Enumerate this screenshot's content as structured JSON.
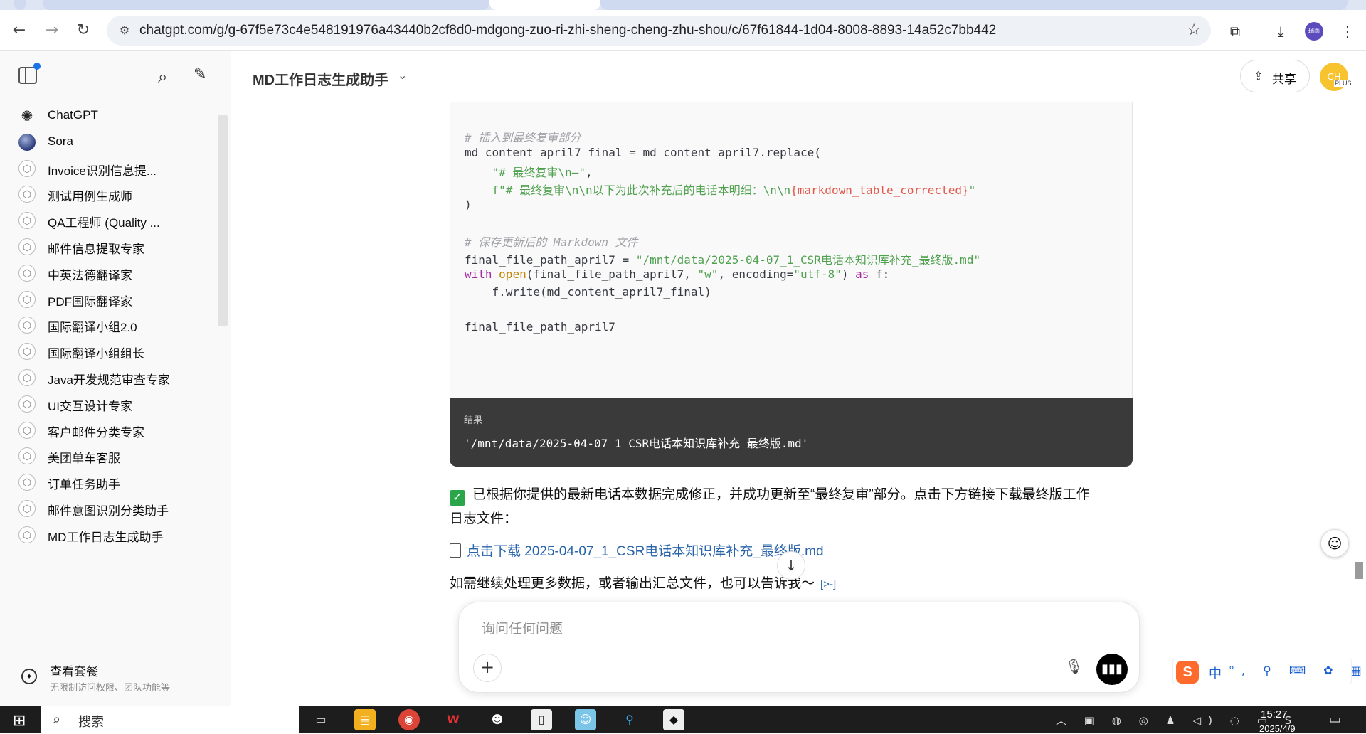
{
  "browser": {
    "url": "chatgpt.com/g/g-67f5e73c4e548191976a43440b2cf8d0-mdgong-zuo-ri-zhi-sheng-cheng-zhu-shou/c/67f61844-1d04-8008-8893-14a52c7bb442",
    "profile_label": "瑞雨"
  },
  "sidebar": {
    "items": [
      {
        "label": "ChatGPT",
        "icon": "openai-icon"
      },
      {
        "label": "Sora",
        "icon": "sora-icon"
      },
      {
        "label": "Invoice识别信息提...",
        "icon": "gpt-cube-icon"
      },
      {
        "label": "测试用例生成师",
        "icon": "gpt-cube-icon"
      },
      {
        "label": "QA工程师 (Quality ...",
        "icon": "gpt-cube-icon"
      },
      {
        "label": "邮件信息提取专家",
        "icon": "gpt-cube-icon"
      },
      {
        "label": "中英法德翻译家",
        "icon": "gpt-cube-icon"
      },
      {
        "label": "PDF国际翻译家",
        "icon": "gpt-cube-icon"
      },
      {
        "label": "国际翻译小组2.0",
        "icon": "gpt-cube-icon"
      },
      {
        "label": "国际翻译小组组长",
        "icon": "gpt-cube-icon"
      },
      {
        "label": "Java开发规范审查专家",
        "icon": "gpt-cube-icon"
      },
      {
        "label": "UI交互设计专家",
        "icon": "gpt-cube-icon"
      },
      {
        "label": "客户邮件分类专家",
        "icon": "gpt-cube-icon"
      },
      {
        "label": "美团单车客服",
        "icon": "gpt-cube-icon"
      },
      {
        "label": "订单任务助手",
        "icon": "gpt-cube-icon"
      },
      {
        "label": "邮件意图识别分类助手",
        "icon": "gpt-cube-icon"
      },
      {
        "label": "MD工作日志生成助手",
        "icon": "gpt-cube-icon"
      }
    ],
    "plan": {
      "title": "查看套餐",
      "subtitle": "无限制访问权限、团队功能等"
    }
  },
  "header": {
    "title": "MD工作日志生成助手",
    "share_label": "共享",
    "avatar_text": "CH",
    "avatar_badge": "PLUS"
  },
  "code": {
    "lines": [
      {
        "parts": [
          {
            "t": "# 插入到最终复审部分",
            "c": "com"
          }
        ]
      },
      {
        "parts": [
          {
            "t": "md_content_april7_final = md_content_april7.replace(",
            "c": ""
          }
        ]
      },
      {
        "parts": [
          {
            "t": "    ",
            "c": ""
          },
          {
            "t": "\"# 最终复审\\n—\"",
            "c": "str"
          },
          {
            "t": ",",
            "c": ""
          }
        ]
      },
      {
        "parts": [
          {
            "t": "    ",
            "c": ""
          },
          {
            "t": "f\"# 最终复审\\n\\n以下为此次补充后的电话本明细：\\n\\n",
            "c": "str"
          },
          {
            "t": "{markdown_table_corrected}",
            "c": "sub"
          },
          {
            "t": "\"",
            "c": "str"
          }
        ]
      },
      {
        "parts": [
          {
            "t": ")",
            "c": ""
          }
        ]
      },
      {
        "parts": [
          {
            "t": "",
            "c": ""
          }
        ]
      },
      {
        "parts": [
          {
            "t": "# 保存更新后的 Markdown 文件",
            "c": "com"
          }
        ]
      },
      {
        "parts": [
          {
            "t": "final_file_path_april7 = ",
            "c": ""
          },
          {
            "t": "\"/mnt/data/2025-04-07_1_CSR电话本知识库补充_最终版.md\"",
            "c": "str"
          }
        ]
      },
      {
        "parts": [
          {
            "t": "with",
            "c": "kw"
          },
          {
            "t": " ",
            "c": ""
          },
          {
            "t": "open",
            "c": "fn"
          },
          {
            "t": "(final_file_path_april7, ",
            "c": ""
          },
          {
            "t": "\"w\"",
            "c": "str"
          },
          {
            "t": ", encoding=",
            "c": ""
          },
          {
            "t": "\"utf-8\"",
            "c": "str"
          },
          {
            "t": ") ",
            "c": ""
          },
          {
            "t": "as",
            "c": "kw"
          },
          {
            "t": " f:",
            "c": ""
          }
        ]
      },
      {
        "parts": [
          {
            "t": "    f.write(md_content_april7_final)",
            "c": ""
          }
        ]
      },
      {
        "parts": [
          {
            "t": "",
            "c": ""
          }
        ]
      },
      {
        "parts": [
          {
            "t": "final_file_path_april7",
            "c": ""
          }
        ]
      }
    ],
    "result_label": "结果",
    "result_value": "'/mnt/data/2025-04-07_1_CSR电话本知识库补充_最终版.md'"
  },
  "message": {
    "line1": "已根据你提供的最新电话本数据完成修正，并成功更新至“最终复审”部分。点击下方链接下载最终版工作",
    "line2": "日志文件：",
    "link": "点击下载 2025-04-07_1_CSR电话本知识库补充_最终版.md",
    "line3": "如需继续处理更多数据，或者输出汇总文件，也可以告诉我～",
    "cite": "[>-]"
  },
  "composer": {
    "placeholder": "询问任何问题"
  },
  "ime": {
    "mode": "中"
  },
  "taskbar": {
    "search_label": "搜索",
    "time": "15:27",
    "date": "2025/4/9"
  }
}
